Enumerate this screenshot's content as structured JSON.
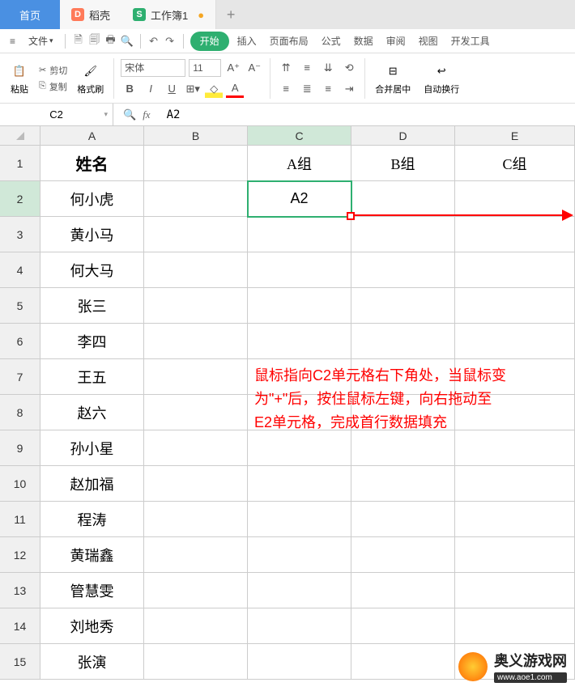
{
  "tabs": {
    "home": "首页",
    "doc1": "稻壳",
    "doc2": "工作簿1",
    "dirty": "●"
  },
  "menu": {
    "file": "文件",
    "items": [
      "开始",
      "插入",
      "页面布局",
      "公式",
      "数据",
      "审阅",
      "视图",
      "开发工具"
    ]
  },
  "toolbar": {
    "paste": "粘贴",
    "cut": "剪切",
    "copy": "复制",
    "fmt_painter": "格式刷",
    "font_name": "宋体",
    "font_size": "11",
    "bold": "B",
    "italic": "I",
    "underline": "U",
    "merge": "合并居中",
    "wrap": "自动换行"
  },
  "namebox": "C2",
  "formula": "A2",
  "columns": [
    "A",
    "B",
    "C",
    "D",
    "E"
  ],
  "rows": [
    "1",
    "2",
    "3",
    "4",
    "5",
    "6",
    "7",
    "8",
    "9",
    "10",
    "11",
    "12",
    "13",
    "14",
    "15"
  ],
  "cells": {
    "A1": "姓名",
    "C1": "A组",
    "D1": "B组",
    "E1": "C组",
    "C2": "A2",
    "A2": "何小虎",
    "A3": "黄小马",
    "A4": "何大马",
    "A5": "张三",
    "A6": "李四",
    "A7": "王五",
    "A8": "赵六",
    "A9": "孙小星",
    "A10": "赵加福",
    "A11": "程涛",
    "A12": "黄瑞鑫",
    "A13": "管慧雯",
    "A14": "刘地秀",
    "A15": "张演"
  },
  "selected_cell": "C2",
  "annotation": {
    "line1": "鼠标指向C2单元格右下角处，当鼠标变",
    "line2": "为\"+\"后，按住鼠标左键，向右拖动至",
    "line3": "E2单元格，完成首行数据填充"
  },
  "watermark": {
    "title": "奥义游戏网",
    "url": "www.aoe1.com"
  }
}
